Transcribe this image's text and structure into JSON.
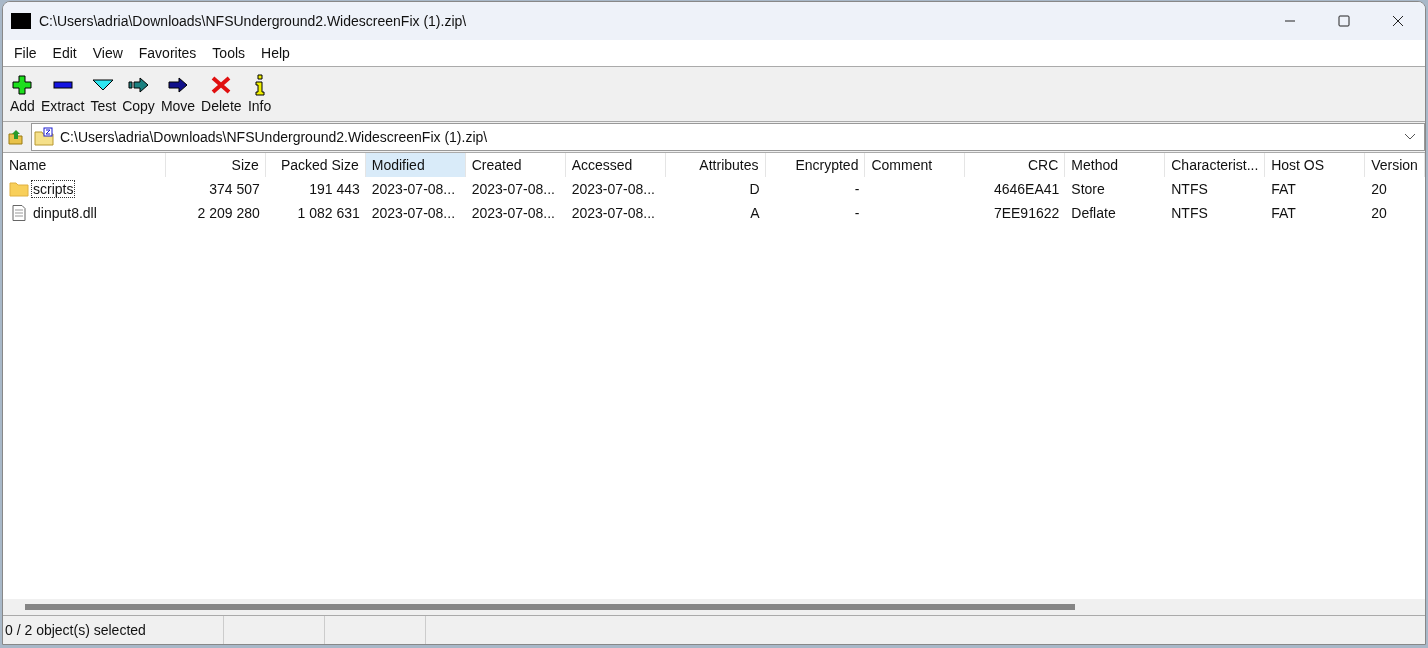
{
  "window": {
    "title": "C:\\Users\\adria\\Downloads\\NFSUnderground2.WidescreenFix (1).zip\\"
  },
  "menu": [
    "File",
    "Edit",
    "View",
    "Favorites",
    "Tools",
    "Help"
  ],
  "toolbar": [
    {
      "label": "Add",
      "kind": "add"
    },
    {
      "label": "Extract",
      "kind": "extract"
    },
    {
      "label": "Test",
      "kind": "test"
    },
    {
      "label": "Copy",
      "kind": "copy"
    },
    {
      "label": "Move",
      "kind": "move"
    },
    {
      "label": "Delete",
      "kind": "delete"
    },
    {
      "label": "Info",
      "kind": "info"
    }
  ],
  "address": {
    "value": "C:\\Users\\adria\\Downloads\\NFSUnderground2.WidescreenFix (1).zip\\"
  },
  "table": {
    "columns": [
      {
        "label": "Name",
        "selected": false
      },
      {
        "label": "Size",
        "selected": false
      },
      {
        "label": "Packed Size",
        "selected": false
      },
      {
        "label": "Modified",
        "selected": true
      },
      {
        "label": "Created",
        "selected": false
      },
      {
        "label": "Accessed",
        "selected": false
      },
      {
        "label": "Attributes",
        "selected": false
      },
      {
        "label": "Encrypted",
        "selected": false
      },
      {
        "label": "Comment",
        "selected": false
      },
      {
        "label": "CRC",
        "selected": false
      },
      {
        "label": "Method",
        "selected": false
      },
      {
        "label": "Characterist...",
        "selected": false
      },
      {
        "label": "Host OS",
        "selected": false
      },
      {
        "label": "Version",
        "selected": false
      }
    ],
    "rows": [
      {
        "kind": "folder",
        "focused": true,
        "cells": [
          "scripts",
          "374 507",
          "191 443",
          "2023-07-08...",
          "2023-07-08...",
          "2023-07-08...",
          "D",
          "-",
          "",
          "4646EA41",
          "Store",
          "NTFS",
          "FAT",
          "20"
        ]
      },
      {
        "kind": "file",
        "focused": false,
        "cells": [
          "dinput8.dll",
          "2 209 280",
          "1 082 631",
          "2023-07-08...",
          "2023-07-08...",
          "2023-07-08...",
          "A",
          "-",
          "",
          "7EE91622",
          "Deflate",
          "NTFS",
          "FAT",
          "20"
        ]
      }
    ]
  },
  "status_bar": {
    "text": "0 / 2 object(s) selected"
  }
}
